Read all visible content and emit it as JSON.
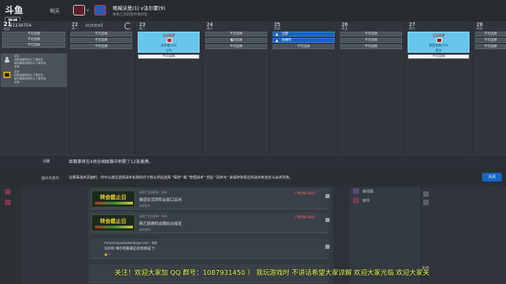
{
  "header": {
    "logo_main": "斗鱼",
    "logo_sub": "游戏站",
    "day_label": "明天",
    "vs": "v",
    "match_title": "塔姆沃思(1) v法尔霍(9)",
    "match_sub": "英格兰非联赛杯第四轮"
  },
  "left_column": {
    "date": "21",
    "weekday": "周日",
    "id_text": "21134754",
    "slots": [
      "不可选择",
      "不可选择",
      "不可选择"
    ],
    "notes": [
      {
        "icon": "person-icon",
        "lines": [
          "全队",
          "训练强度较好以下青年队",
          "球队精英训练好以下青年队",
          "全体"
        ]
      },
      {
        "icon": "badge-icon",
        "lines": [
          "全队",
          "训练强度较好以下青年队",
          "球队精英训练好以下青年队",
          "全体"
        ]
      }
    ]
  },
  "calendar": {
    "month": "2025年9月",
    "days": [
      {
        "num": "22",
        "weekday": "周一",
        "month": "2025年9月",
        "slots": [
          "不可选择",
          "不可选择",
          "不可选择"
        ]
      },
      {
        "num": "23",
        "weekday": "周二",
        "match": {
          "top": "全国联赛",
          "name": "法尔霍(10)",
          "loc": "主场"
        },
        "slots": [
          "不可选择"
        ]
      },
      {
        "num": "24",
        "weekday": "周三",
        "slots": [
          "不可选择",
          "不可选择",
          "不可选择"
        ]
      },
      {
        "num": "25",
        "weekday": "周四",
        "blue": [
          "全部",
          "防硬率"
        ],
        "slots": [
          "不可选择"
        ]
      },
      {
        "num": "26",
        "weekday": "周五",
        "slots": [
          "不可选择",
          "不可选择",
          "不可选择"
        ]
      },
      {
        "num": "27",
        "weekday": "周六",
        "match": {
          "top": "全国联赛",
          "name": "斯亚姆利(10)",
          "loc": "客场"
        },
        "slots": [
          "不可选择"
        ]
      },
      {
        "num": "28",
        "weekday": "周日",
        "slots": [
          "不可选择",
          "不可选择",
          "不可选择"
        ]
      }
    ]
  },
  "info_bar": {
    "label": "前瞻",
    "text": "距赛事将在4场全国联赛中积累了12张黄牌。"
  },
  "tip_bar": {
    "label": "提示与技巧",
    "text": "在赛事战术页面时，你可以通过选择战术名称的向下箭头然后选择 \"保存\" 或 \"管理战术\" 然后 \"另存为\" 来保存你现在的战术到自定义战术列表。",
    "close": "关闭"
  },
  "feed": [
    {
      "banner": "转会截止日",
      "meta": "英格兰全国联赛 · 新闻",
      "title": "报道优克西转会窗口关闭",
      "small": "阅读更多",
      "tag": "[ 转会窗口关闭 ]"
    },
    {
      "banner": "转会截止日",
      "meta": "英格兰全国联赛 · 新闻",
      "title": "斯乙联赛转会期综合报道",
      "small": "阅读更多",
      "tag": "[ 转会窗口关闭 ]"
    },
    {
      "banner": "",
      "meta": "thenonleaguefootballpaper.com · 刚刚",
      "title": "马尔科 维尔利斯最近状态真是了!",
      "small": "👍 0",
      "tag": ""
    }
  ],
  "right_panel": {
    "items": [
      "新闻源",
      "收件"
    ],
    "bottom": "关闭"
  },
  "overlay": "关注！欢迎大家加 QQ 群号：1087931450 ） 我玩游戏时 不讲话希望大家谅解 欢迎大家光临 欢迎大家关"
}
